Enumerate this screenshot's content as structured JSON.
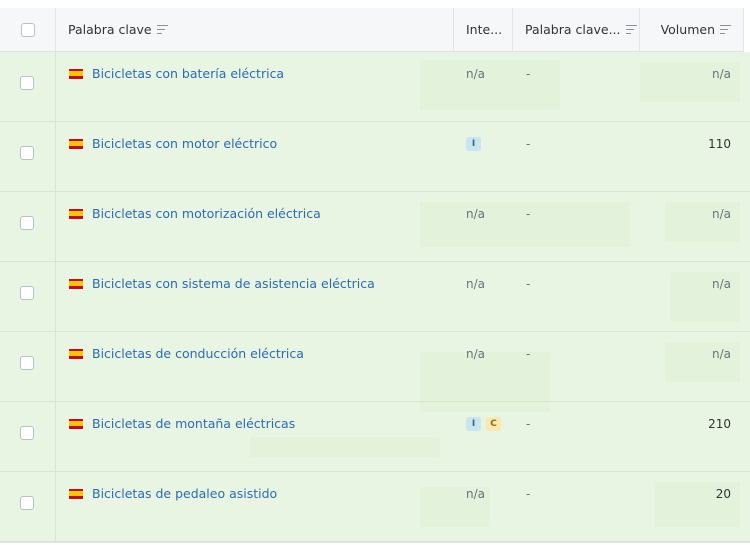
{
  "table": {
    "columns": [
      {
        "label": "Palabra clave"
      },
      {
        "label": "Inte..."
      },
      {
        "label": "Palabra clave..."
      },
      {
        "label": "Volumen"
      }
    ],
    "rows": [
      {
        "keyword": "Bicicletas con batería eléctrica",
        "intent_na": "n/a",
        "intent_badges": [],
        "keyword_col": "-",
        "volume": "n/a"
      },
      {
        "keyword": "Bicicletas con motor eléctrico",
        "intent_na": "",
        "intent_badges": [
          "I"
        ],
        "keyword_col": "-",
        "volume": "110"
      },
      {
        "keyword": "Bicicletas con motorización eléctrica",
        "intent_na": "n/a",
        "intent_badges": [],
        "keyword_col": "-",
        "volume": "n/a"
      },
      {
        "keyword": "Bicicletas con sistema de asistencia eléctrica",
        "intent_na": "n/a",
        "intent_badges": [],
        "keyword_col": "-",
        "volume": "n/a"
      },
      {
        "keyword": "Bicicletas de conducción eléctrica",
        "intent_na": "n/a",
        "intent_badges": [],
        "keyword_col": "-",
        "volume": "n/a"
      },
      {
        "keyword": "Bicicletas de montaña eléctricas",
        "intent_na": "",
        "intent_badges": [
          "I",
          "C"
        ],
        "keyword_col": "-",
        "volume": "210"
      },
      {
        "keyword": "Bicicletas de pedaleo asistido",
        "intent_na": "n/a",
        "intent_badges": [],
        "keyword_col": "-",
        "volume": "20"
      }
    ]
  },
  "colors": {
    "row_background": "#e9f5e3",
    "header_background": "#f6f7f8",
    "link": "#2b6bb3",
    "intent_i": "#c8e5f0",
    "intent_c": "#fbe7b0"
  },
  "icons": {
    "flag": "spain-flag-icon",
    "sort": "sort-icon"
  }
}
